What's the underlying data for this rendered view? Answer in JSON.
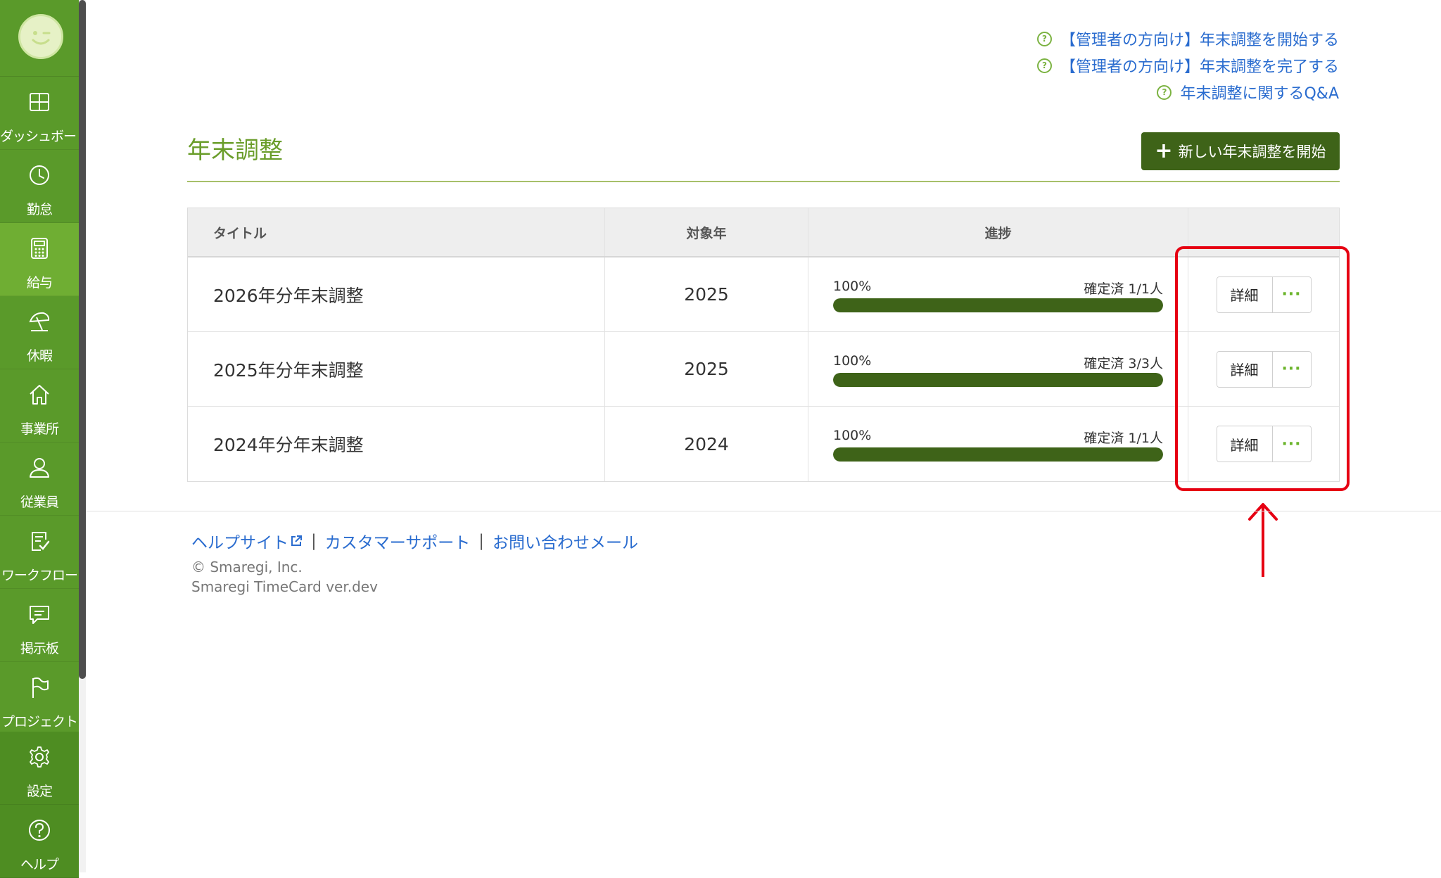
{
  "sidebar": {
    "items": [
      {
        "label": "ダッシュボード",
        "icon": "dashboard-icon"
      },
      {
        "label": "勤怠",
        "icon": "clock-icon"
      },
      {
        "label": "給与",
        "icon": "calculator-icon"
      },
      {
        "label": "休暇",
        "icon": "beach-umbrella-icon"
      },
      {
        "label": "事業所",
        "icon": "home-icon"
      },
      {
        "label": "従業員",
        "icon": "person-icon"
      },
      {
        "label": "ワークフロー",
        "icon": "checklist-icon"
      },
      {
        "label": "掲示板",
        "icon": "chat-bubble-icon"
      },
      {
        "label": "プロジェクト",
        "icon": "flag-icon"
      }
    ],
    "bottom": [
      {
        "label": "設定",
        "icon": "gear-icon"
      },
      {
        "label": "ヘルプ",
        "icon": "help-icon"
      }
    ],
    "active_index": 2
  },
  "help_links": [
    "【管理者の方向け】年末調整を開始する",
    "【管理者の方向け】年末調整を完了する",
    "年末調整に関するQ&A"
  ],
  "page": {
    "title": "年末調整",
    "new_button": "新しい年末調整を開始"
  },
  "table": {
    "headers": {
      "title": "タイトル",
      "year": "対象年",
      "progress": "進捗",
      "actions": ""
    },
    "rows": [
      {
        "title": "2026年分年末調整",
        "year": "2025",
        "percent": "100%",
        "status": "確定済 1/1人",
        "progress": 1.0,
        "detail": "詳細",
        "more": "···"
      },
      {
        "title": "2025年分年末調整",
        "year": "2025",
        "percent": "100%",
        "status": "確定済 3/3人",
        "progress": 1.0,
        "detail": "詳細",
        "more": "···"
      },
      {
        "title": "2024年分年末調整",
        "year": "2024",
        "percent": "100%",
        "status": "確定済 1/1人",
        "progress": 1.0,
        "detail": "詳細",
        "more": "···"
      }
    ]
  },
  "footer": {
    "help_site": "ヘルプサイト",
    "support": "カスタマーサポート",
    "contact": "お問い合わせメール",
    "separator": "|",
    "copyright": "© Smaregi, Inc.",
    "version": "Smaregi TimeCard ver.dev"
  },
  "colors": {
    "sidebar": "#5a9a2a",
    "sidebar_active": "#6fae33",
    "accent_dark": "#3e6318",
    "link": "#2a6ccf",
    "annotation": "#e60012"
  }
}
